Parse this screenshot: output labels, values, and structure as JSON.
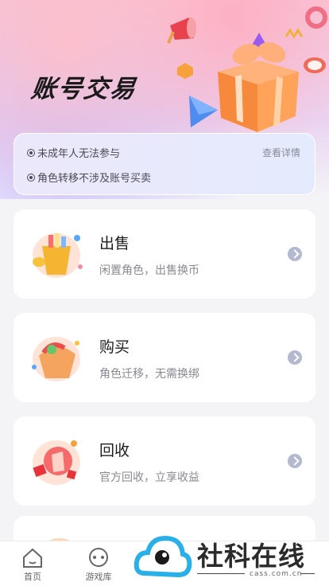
{
  "hero": {
    "title": "账号交易"
  },
  "notice": {
    "line1": "未成年人无法参与",
    "line2": "角色转移不涉及账号买卖",
    "details_link": "查看详情"
  },
  "cards": [
    {
      "title": "出售",
      "subtitle": "闲置角色，出售换币"
    },
    {
      "title": "购买",
      "subtitle": "角色迁移，无需换绑"
    },
    {
      "title": "回收",
      "subtitle": "官方回收，立享收益"
    }
  ],
  "tabbar": {
    "items": [
      {
        "label": "首页",
        "icon": "home-icon"
      },
      {
        "label": "游戏库",
        "icon": "game-library-icon"
      }
    ]
  },
  "watermark": {
    "text": "社科在线",
    "url": "cass.com.cn"
  },
  "colors": {
    "accent": "#b3bad0",
    "title_text": "#1d1d1d",
    "sub_text": "#888890"
  }
}
